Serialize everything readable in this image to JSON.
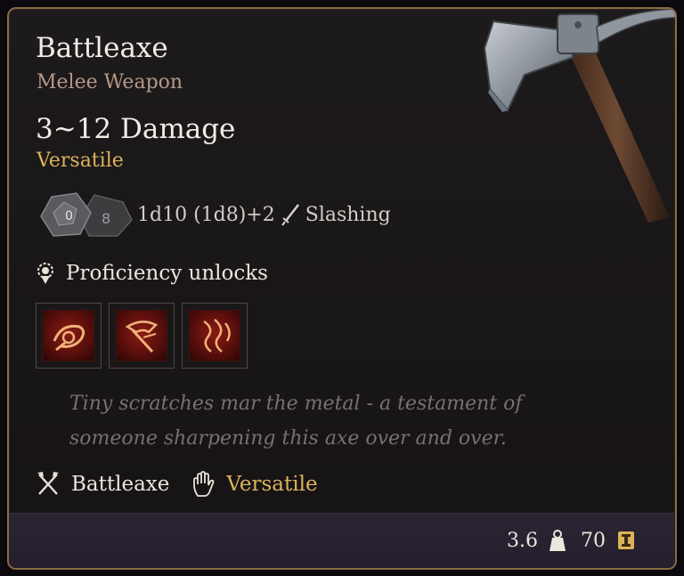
{
  "item": {
    "name": "Battleaxe",
    "category": "Melee Weapon",
    "damage": "3~12 Damage",
    "trait": "Versatile",
    "dice_main": "0",
    "dice_secondary": "8",
    "damage_formula": "1d10 (1d8)+2",
    "damage_type": "Slashing",
    "proficiency_label": "Proficiency unlocks",
    "lore": "Tiny scratches mar the metal - a testament of someone sharpening this axe over and over.",
    "properties": [
      {
        "label": "Battleaxe",
        "icon": "crossed-axes-icon"
      },
      {
        "label": "Versatile",
        "icon": "hand-icon"
      }
    ],
    "weight": "3.6",
    "value": "70"
  },
  "colors": {
    "accent_gold": "#dcb35a",
    "subtitle": "#b49a86",
    "border": "#8a6a45",
    "skill_red": "#8a1b13"
  }
}
